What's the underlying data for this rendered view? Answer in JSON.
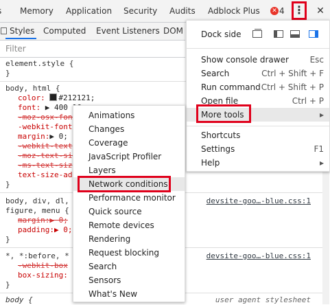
{
  "top_tabs": [
    "Memory",
    "Application",
    "Security",
    "Audits",
    "Adblock Plus"
  ],
  "error_icon": "x-circle-icon",
  "error_count": "4",
  "menu_icon": "⋮",
  "close_icon": "✕",
  "sub_tabs": [
    "Styles",
    "Computed",
    "Event Listeners",
    "DOM"
  ],
  "filter": {
    "placeholder": "Filter"
  },
  "styles": {
    "element_style": "element.style {",
    "close_brace": "}",
    "rule1": {
      "selector": "body, html {",
      "color_prop": "color:",
      "color_val": "#212121;",
      "font_prop": "font:",
      "font_val": "▶ 400 16",
      "moz_osx": "-moz-osx-font",
      "webkit_font": "-webkit-font",
      "margin_prop": "margin:",
      "margin_val": "▶ 0;",
      "webkit_text": "-webkit-text",
      "moz_text": "-moz-text-siz",
      "ms_text": "-ms-text-siz",
      "text_size": "text-size-ad"
    },
    "rule2": {
      "selector": "body, div, dl,",
      "selector2": "figure, menu {",
      "source": "devsite-goo…-blue.css:1",
      "margin": "margin:▶ 0;",
      "padding": "padding:▶ 0;"
    },
    "rule3": {
      "selector": "*, *:before, *",
      "source": "devsite-goo…-blue.css:1",
      "webkit_box": "-webkit-box",
      "box_sizing": "box-sizing:"
    },
    "rule4": {
      "selector": "body {",
      "source": "user agent stylesheet"
    }
  },
  "main_menu": {
    "dock_side": "Dock side",
    "items": [
      {
        "label": "Show console drawer",
        "shortcut": "Esc"
      },
      {
        "label": "Search",
        "shortcut": "Ctrl + Shift + F"
      },
      {
        "label": "Run command",
        "shortcut": "Ctrl + Shift + P"
      },
      {
        "label": "Open file",
        "shortcut": "Ctrl + P"
      },
      {
        "label": "More tools",
        "shortcut": "▸"
      },
      {
        "label": "Shortcuts",
        "shortcut": ""
      },
      {
        "label": "Settings",
        "shortcut": "F1"
      },
      {
        "label": "Help",
        "shortcut": "▸"
      }
    ]
  },
  "more_tools": [
    "Animations",
    "Changes",
    "Coverage",
    "JavaScript Profiler",
    "Layers",
    "Network conditions",
    "Performance monitor",
    "Quick source",
    "Remote devices",
    "Rendering",
    "Request blocking",
    "Search",
    "Sensors",
    "What's New"
  ],
  "colors": {
    "highlight": "#e0001b",
    "selected_dock": "#1a73e8",
    "hover_bg": "#e8e8e8"
  }
}
